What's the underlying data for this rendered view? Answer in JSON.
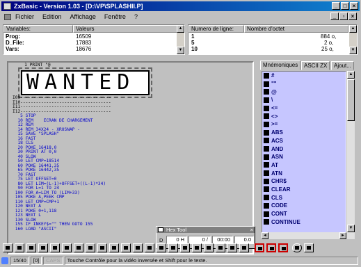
{
  "window": {
    "title": "ZxBasic - Version 1.03 - [D:\\VP\\SPLASHII.P]"
  },
  "menu": [
    "Fichier",
    "Edition",
    "Affichage",
    "Fenêtre",
    "?"
  ],
  "vars": {
    "h1": "Variables:",
    "h2": "Valeurs",
    "rows": [
      [
        "Prog:",
        "16509"
      ],
      [
        "D_File:",
        "17883"
      ],
      [
        "Vars:",
        "18676"
      ]
    ]
  },
  "lines": {
    "h1": "Numero de ligne:",
    "h2": "Nombre d'octet",
    "rows": [
      [
        "1",
        "884 o,"
      ],
      [
        "5",
        "2 o,"
      ],
      [
        "10",
        "25 o,"
      ]
    ]
  },
  "code": {
    "l1": "   1 PRINT \"@",
    "wanted": "WANTED",
    "mid": "I09-----------------------------------\nI10-----------------------------------\nI11-----------------------------------\nI12-----------------------------------",
    "body": "   5 STOP\n  10 REM    ECRAN DE CHARGEMENT\n  12 REM\n  14 REM 34X24 - XRUSNAP -\n  15 SAVE \"SPLASH\"\n  16 FAST\n  18 CLS\n  20 POKE 16418,0\n  30 PRINT AT 0,0\n  40 SLOW\n  50 LET CMP=18514\n  60 POKE 16441,35\n  65 POKE 16442,35\n  70 FAST\n  75 LET OFFSET=0\n  80 LET LIM=(L-1)+OFFSET+((L-1)*34)\n  90 FOR L=1 TO 24\n 100 FOR A=LIM TO (LIM+33)\n 105 POKE A,PEEK CMP\n 110 LET CMP=CMP+1\n 120 NEXT A\n 121 POKE 0+1,118\n 123 NEXT L\n 130 SLOW\n 155 IF INKEY$=\"\" THEN GOTO 155\n 160 LOAD \"ASCII\""
  },
  "tabs": [
    "Mnémoniques",
    "ASCII ZX",
    "Ajout..."
  ],
  "keywords": [
    "#",
    "\"\"",
    "@",
    "\\",
    "<=",
    "<>",
    ">=",
    "ABS",
    "ACS",
    "AND",
    "ASN",
    "AT",
    "ATN",
    "CHR$",
    "CLEAR",
    "CLS",
    "CODE",
    "CONT",
    "CONTINUE"
  ],
  "hex": {
    "title": "Hex Tool",
    "d": "D",
    "v1": "0 H",
    "v2": "0 /",
    "v3": "00:00",
    "v4": "0.0"
  },
  "status": {
    "pos": "15/40",
    "num": "[0]",
    "caps": "CAPS",
    "msg": "Touche Contrôle pour la vidéo inversée et Shift pour le texte."
  }
}
